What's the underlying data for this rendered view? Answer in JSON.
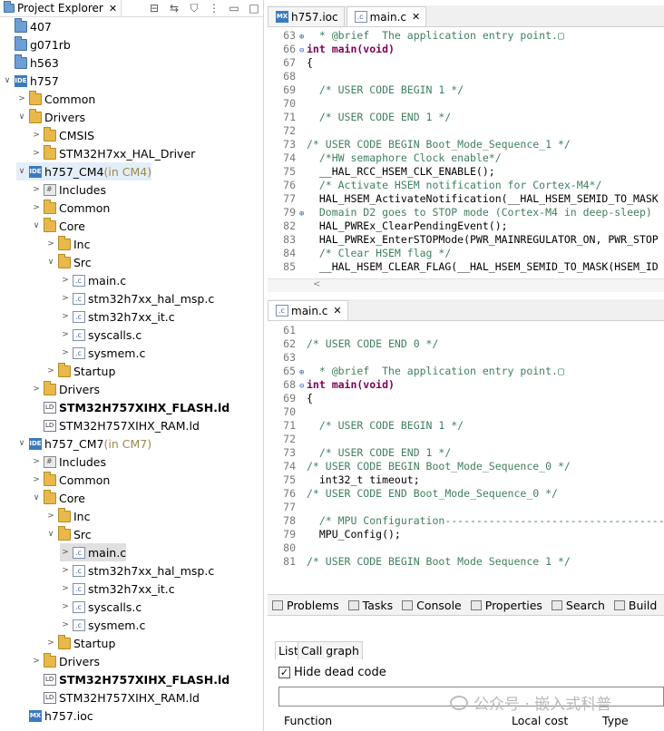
{
  "project_explorer": {
    "title": "Project Explorer",
    "tree": [
      {
        "label": "407",
        "indent": 0,
        "tw": "",
        "icon": "folder-blue-icon"
      },
      {
        "label": "g071rb",
        "indent": 0,
        "tw": "",
        "icon": "folder-blue-icon"
      },
      {
        "label": "h563",
        "indent": 0,
        "tw": "",
        "icon": "folder-blue-icon"
      },
      {
        "label": "h757",
        "indent": 0,
        "tw": "∨",
        "icon": "ide-project-icon"
      },
      {
        "label": "Common",
        "indent": 1,
        "tw": ">",
        "icon": "folder-icon"
      },
      {
        "label": "Drivers",
        "indent": 1,
        "tw": "∨",
        "icon": "folder-icon"
      },
      {
        "label": "CMSIS",
        "indent": 2,
        "tw": ">",
        "icon": "folder-icon"
      },
      {
        "label": "STM32H7xx_HAL_Driver",
        "indent": 2,
        "tw": ">",
        "icon": "folder-icon"
      },
      {
        "label": "h757_CM4",
        "suffix": " (in CM4)",
        "indent": 1,
        "tw": "∨",
        "icon": "ide-project-icon",
        "hl": true
      },
      {
        "label": "Includes",
        "indent": 2,
        "tw": ">",
        "icon": "includes-icon"
      },
      {
        "label": "Common",
        "indent": 2,
        "tw": ">",
        "icon": "folder-icon"
      },
      {
        "label": "Core",
        "indent": 2,
        "tw": "∨",
        "icon": "folder-icon"
      },
      {
        "label": "Inc",
        "indent": 3,
        "tw": ">",
        "icon": "folder-icon"
      },
      {
        "label": "Src",
        "indent": 3,
        "tw": "∨",
        "icon": "folder-icon"
      },
      {
        "label": "main.c",
        "indent": 4,
        "tw": ">",
        "icon": "c-file-icon"
      },
      {
        "label": "stm32h7xx_hal_msp.c",
        "indent": 4,
        "tw": ">",
        "icon": "c-file-icon"
      },
      {
        "label": "stm32h7xx_it.c",
        "indent": 4,
        "tw": ">",
        "icon": "c-file-icon"
      },
      {
        "label": "syscalls.c",
        "indent": 4,
        "tw": ">",
        "icon": "c-file-icon"
      },
      {
        "label": "sysmem.c",
        "indent": 4,
        "tw": ">",
        "icon": "c-file-icon"
      },
      {
        "label": "Startup",
        "indent": 3,
        "tw": ">",
        "icon": "folder-icon"
      },
      {
        "label": "Drivers",
        "indent": 2,
        "tw": ">",
        "icon": "folder-icon"
      },
      {
        "label": "STM32H757XIHX_FLASH.ld",
        "indent": 2,
        "tw": "",
        "icon": "ld-file-icon",
        "bold": true
      },
      {
        "label": "STM32H757XIHX_RAM.ld",
        "indent": 2,
        "tw": "",
        "icon": "ld-file-icon"
      },
      {
        "label": "h757_CM7",
        "suffix": " (in CM7)",
        "indent": 1,
        "tw": "∨",
        "icon": "ide-project-icon"
      },
      {
        "label": "Includes",
        "indent": 2,
        "tw": ">",
        "icon": "includes-icon"
      },
      {
        "label": "Common",
        "indent": 2,
        "tw": ">",
        "icon": "folder-icon"
      },
      {
        "label": "Core",
        "indent": 2,
        "tw": "∨",
        "icon": "folder-icon"
      },
      {
        "label": "Inc",
        "indent": 3,
        "tw": ">",
        "icon": "folder-icon"
      },
      {
        "label": "Src",
        "indent": 3,
        "tw": "∨",
        "icon": "folder-icon"
      },
      {
        "label": "main.c",
        "indent": 4,
        "tw": ">",
        "icon": "c-file-icon",
        "selected": true
      },
      {
        "label": "stm32h7xx_hal_msp.c",
        "indent": 4,
        "tw": ">",
        "icon": "c-file-icon"
      },
      {
        "label": "stm32h7xx_it.c",
        "indent": 4,
        "tw": ">",
        "icon": "c-file-icon"
      },
      {
        "label": "syscalls.c",
        "indent": 4,
        "tw": ">",
        "icon": "c-file-icon"
      },
      {
        "label": "sysmem.c",
        "indent": 4,
        "tw": ">",
        "icon": "c-file-icon"
      },
      {
        "label": "Startup",
        "indent": 3,
        "tw": ">",
        "icon": "folder-icon"
      },
      {
        "label": "Drivers",
        "indent": 2,
        "tw": ">",
        "icon": "folder-icon"
      },
      {
        "label": "STM32H757XIHX_FLASH.ld",
        "indent": 2,
        "tw": "",
        "icon": "ld-file-icon",
        "bold": true
      },
      {
        "label": "STM32H757XIHX_RAM.ld",
        "indent": 2,
        "tw": "",
        "icon": "ld-file-icon"
      },
      {
        "label": "h757.ioc",
        "indent": 1,
        "tw": "",
        "icon": "mx-file-icon"
      }
    ]
  },
  "editor1": {
    "tabs": [
      {
        "label": "h757.ioc",
        "icon": "mx-file-icon"
      },
      {
        "label": "main.c",
        "icon": "c-file-icon",
        "active": true
      }
    ],
    "lines": [
      {
        "n": "63",
        "fold": "⊕",
        "text": "  * @brief  The application entry point.▢",
        "cls": "cm"
      },
      {
        "n": "66",
        "fold": "⊖",
        "text": "int main(void)",
        "cls": "kwline"
      },
      {
        "n": "67",
        "fold": "",
        "text": "{",
        "cls": ""
      },
      {
        "n": "68",
        "fold": "",
        "text": "",
        "cls": ""
      },
      {
        "n": "69",
        "fold": "",
        "text": "  /* USER CODE BEGIN 1 */",
        "cls": "cm"
      },
      {
        "n": "70",
        "fold": "",
        "text": "",
        "cls": ""
      },
      {
        "n": "71",
        "fold": "",
        "text": "  /* USER CODE END 1 */",
        "cls": "cm"
      },
      {
        "n": "72",
        "fold": "",
        "text": "",
        "cls": ""
      },
      {
        "n": "73",
        "fold": "",
        "text": "/* USER CODE BEGIN Boot_Mode_Sequence_1 */",
        "cls": "cm"
      },
      {
        "n": "74",
        "fold": "",
        "text": "  /*HW semaphore Clock enable*/",
        "cls": "cm"
      },
      {
        "n": "75",
        "fold": "",
        "text": "  __HAL_RCC_HSEM_CLK_ENABLE();",
        "cls": ""
      },
      {
        "n": "76",
        "fold": "",
        "text": "  /* Activate HSEM notification for Cortex-M4*/",
        "cls": "cm"
      },
      {
        "n": "77",
        "fold": "",
        "text": "  HAL_HSEM_ActivateNotification(__HAL_HSEM_SEMID_TO_MASK",
        "cls": ""
      },
      {
        "n": "79",
        "fold": "⊕",
        "text": "  Domain D2 goes to STOP mode (Cortex-M4 in deep-sleep)",
        "cls": "cm"
      },
      {
        "n": "82",
        "fold": "",
        "text": "  HAL_PWREx_ClearPendingEvent();",
        "cls": ""
      },
      {
        "n": "83",
        "fold": "",
        "text": "  HAL_PWREx_EnterSTOPMode(PWR_MAINREGULATOR_ON, PWR_STOP",
        "cls": ""
      },
      {
        "n": "84",
        "fold": "",
        "text": "  /* Clear HSEM flag */",
        "cls": "cm"
      },
      {
        "n": "85",
        "fold": "",
        "text": "  __HAL_HSEM_CLEAR_FLAG(__HAL_HSEM_SEMID_TO_MASK(HSEM_ID",
        "cls": ""
      }
    ]
  },
  "editor2": {
    "tabs": [
      {
        "label": "main.c",
        "icon": "c-file-icon",
        "active": true
      }
    ],
    "lines": [
      {
        "n": "61",
        "fold": "",
        "text": "",
        "cls": ""
      },
      {
        "n": "62",
        "fold": "",
        "text": "/* USER CODE END 0 */",
        "cls": "cm"
      },
      {
        "n": "63",
        "fold": "",
        "text": "",
        "cls": ""
      },
      {
        "n": "65",
        "fold": "⊕",
        "text": "  * @brief  The application entry point.▢",
        "cls": "cm"
      },
      {
        "n": "68",
        "fold": "⊖",
        "text": "int main(void)",
        "cls": "kwline"
      },
      {
        "n": "69",
        "fold": "",
        "text": "{",
        "cls": ""
      },
      {
        "n": "70",
        "fold": "",
        "text": "",
        "cls": ""
      },
      {
        "n": "71",
        "fold": "",
        "text": "  /* USER CODE BEGIN 1 */",
        "cls": "cm"
      },
      {
        "n": "72",
        "fold": "",
        "text": "",
        "cls": ""
      },
      {
        "n": "73",
        "fold": "",
        "text": "  /* USER CODE END 1 */",
        "cls": "cm"
      },
      {
        "n": "74",
        "fold": "",
        "text": "/* USER CODE BEGIN Boot_Mode_Sequence_0 */",
        "cls": "cm"
      },
      {
        "n": "75",
        "fold": "",
        "text": "  int32_t timeout;",
        "cls": ""
      },
      {
        "n": "76",
        "fold": "",
        "text": "/* USER CODE END Boot_Mode_Sequence_0 */",
        "cls": "cm"
      },
      {
        "n": "77",
        "fold": "",
        "text": "",
        "cls": ""
      },
      {
        "n": "78",
        "fold": "",
        "text": "  /* MPU Configuration----------------------------------------",
        "cls": "cm"
      },
      {
        "n": "79",
        "fold": "",
        "text": "  MPU_Config();",
        "cls": ""
      },
      {
        "n": "80",
        "fold": "",
        "text": "",
        "cls": ""
      },
      {
        "n": "81",
        "fold": "",
        "text": "/* USER CODE BEGIN Boot_Mode_Sequence_1 */",
        "cls": "cm"
      }
    ]
  },
  "bottom": {
    "tabs": [
      {
        "label": "Problems",
        "icon": "problems-icon"
      },
      {
        "label": "Tasks",
        "icon": "tasks-icon"
      },
      {
        "label": "Console",
        "icon": "console-icon"
      },
      {
        "label": "Properties",
        "icon": "properties-icon"
      },
      {
        "label": "Search",
        "icon": "search-icon"
      },
      {
        "label": "Build",
        "icon": "build-icon"
      }
    ],
    "subtabs": [
      "List",
      "Call graph"
    ],
    "checkbox_label": "Hide dead code",
    "columns": [
      "Function",
      "Local cost",
      "Type"
    ]
  },
  "watermark": "公众号 · 嵌入式科普"
}
